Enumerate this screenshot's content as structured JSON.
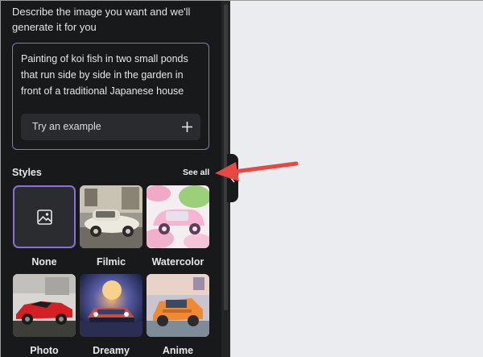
{
  "panel": {
    "intro": "Describe the image you want and we'll generate it for you",
    "prompt": "Painting of koi fish in two small ponds that run side by side in the garden in front of a traditional Japanese house",
    "try_example": "Try an example"
  },
  "styles": {
    "title": "Styles",
    "see_all": "See all",
    "items": [
      {
        "label": "None"
      },
      {
        "label": "Filmic"
      },
      {
        "label": "Watercolor"
      },
      {
        "label": "Photo"
      },
      {
        "label": "Dreamy"
      },
      {
        "label": "Anime"
      }
    ]
  },
  "colors": {
    "panel_bg": "#18191b",
    "accent": "#8b6fd6",
    "annotation_arrow": "#e8483f",
    "canvas_bg": "#ebecf0"
  }
}
